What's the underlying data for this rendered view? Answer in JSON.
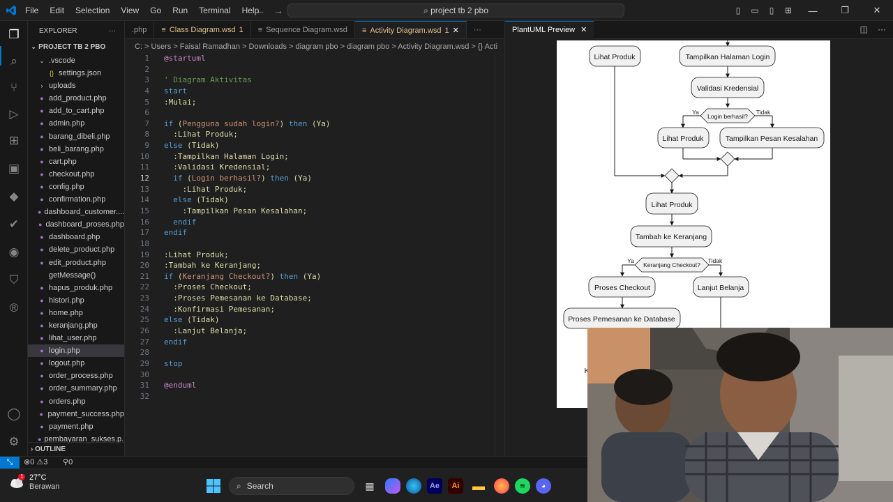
{
  "titlebar": {
    "menu": [
      "File",
      "Edit",
      "Selection",
      "View",
      "Go",
      "Run",
      "Terminal",
      "Help"
    ],
    "search_text": "project tb 2 pbo"
  },
  "explorer": {
    "header": "EXPLORER",
    "project": "PROJECT TB 2 PBO",
    "outline": "OUTLINE",
    "files": [
      {
        "name": ".vscode",
        "kind": "folder-open",
        "indent": 1
      },
      {
        "name": "settings.json",
        "kind": "json",
        "indent": 2
      },
      {
        "name": "uploads",
        "kind": "folder",
        "indent": 1
      },
      {
        "name": "add_product.php",
        "kind": "php",
        "indent": 1
      },
      {
        "name": "add_to_cart.php",
        "kind": "php",
        "indent": 1
      },
      {
        "name": "admin.php",
        "kind": "php",
        "indent": 1
      },
      {
        "name": "barang_dibeli.php",
        "kind": "php",
        "indent": 1
      },
      {
        "name": "beli_barang.php",
        "kind": "php",
        "indent": 1
      },
      {
        "name": "cart.php",
        "kind": "php",
        "indent": 1
      },
      {
        "name": "checkout.php",
        "kind": "php",
        "indent": 1
      },
      {
        "name": "config.php",
        "kind": "php",
        "indent": 1
      },
      {
        "name": "confirmation.php",
        "kind": "php",
        "indent": 1
      },
      {
        "name": "dashboard_customer....",
        "kind": "php",
        "indent": 1
      },
      {
        "name": "dashboard_proses.php",
        "kind": "php",
        "indent": 1
      },
      {
        "name": "dashboard.php",
        "kind": "php",
        "indent": 1
      },
      {
        "name": "delete_product.php",
        "kind": "php",
        "indent": 1
      },
      {
        "name": "edit_product.php",
        "kind": "php",
        "indent": 1
      },
      {
        "name": "getMessage()",
        "kind": "none",
        "indent": 1
      },
      {
        "name": "hapus_produk.php",
        "kind": "php",
        "indent": 1
      },
      {
        "name": "histori.php",
        "kind": "php",
        "indent": 1
      },
      {
        "name": "home.php",
        "kind": "php",
        "indent": 1
      },
      {
        "name": "keranjang.php",
        "kind": "php",
        "indent": 1
      },
      {
        "name": "lihat_user.php",
        "kind": "php",
        "indent": 1
      },
      {
        "name": "login.php",
        "kind": "php",
        "indent": 1,
        "selected": true
      },
      {
        "name": "logout.php",
        "kind": "php",
        "indent": 1
      },
      {
        "name": "order_process.php",
        "kind": "php",
        "indent": 1
      },
      {
        "name": "order_summary.php",
        "kind": "php",
        "indent": 1
      },
      {
        "name": "orders.php",
        "kind": "php",
        "indent": 1
      },
      {
        "name": "payment_success.php",
        "kind": "php",
        "indent": 1
      },
      {
        "name": "payment.php",
        "kind": "php",
        "indent": 1
      },
      {
        "name": "pembayaran_sukses.p...",
        "kind": "php",
        "indent": 1
      }
    ]
  },
  "tabs": [
    {
      "label": ".php",
      "badge": "",
      "active": false
    },
    {
      "label": "Class Diagram.wsd",
      "badge": "1",
      "active": false
    },
    {
      "label": "Sequence Diagram.wsd",
      "badge": "",
      "active": false
    },
    {
      "label": "Activity Diagram.wsd",
      "badge": "1",
      "active": true
    }
  ],
  "breadcrumb": "C: > Users > Faisal Ramadhan > Downloads > diagram pbo > diagram pbo > Activity Diagram.wsd > {} Acti",
  "code": [
    {
      "n": "1",
      "t": "@startuml",
      "c": "bl"
    },
    {
      "n": "2",
      "t": "",
      "c": "pn"
    },
    {
      "n": "3",
      "t": "' Diagram Aktivitas",
      "c": "cm"
    },
    {
      "n": "4",
      "t": "start",
      "c": "kw"
    },
    {
      "n": "5",
      "t": ":Mulai;",
      "c": "fn"
    },
    {
      "n": "6",
      "t": "",
      "c": "pn"
    },
    {
      "n": "7",
      "t": "if (Pengguna sudah login?) then (Ya)",
      "c": "if"
    },
    {
      "n": "8",
      "t": "  :Lihat Produk;",
      "c": "fn"
    },
    {
      "n": "9",
      "t": "else (Tidak)",
      "c": "else"
    },
    {
      "n": "10",
      "t": "  :Tampilkan Halaman Login;",
      "c": "fn"
    },
    {
      "n": "11",
      "t": "  :Validasi Kredensial;",
      "c": "fn"
    },
    {
      "n": "12",
      "t": "  if (Login berhasil?) then (Ya)",
      "c": "if"
    },
    {
      "n": "13",
      "t": "    :Lihat Produk;",
      "c": "fn"
    },
    {
      "n": "14",
      "t": "  else (Tidak)",
      "c": "else"
    },
    {
      "n": "15",
      "t": "    :Tampilkan Pesan Kesalahan;",
      "c": "fn"
    },
    {
      "n": "16",
      "t": "  endif",
      "c": "kw"
    },
    {
      "n": "17",
      "t": "endif",
      "c": "kw"
    },
    {
      "n": "18",
      "t": "",
      "c": "pn"
    },
    {
      "n": "19",
      "t": ":Lihat Produk;",
      "c": "fn"
    },
    {
      "n": "20",
      "t": ":Tambah ke Keranjang;",
      "c": "fn"
    },
    {
      "n": "21",
      "t": "if (Keranjang Checkout?) then (Ya)",
      "c": "if"
    },
    {
      "n": "22",
      "t": "  :Proses Checkout;",
      "c": "fn"
    },
    {
      "n": "23",
      "t": "  :Proses Pemesanan ke Database;",
      "c": "fn"
    },
    {
      "n": "24",
      "t": "  :Konfirmasi Pemesanan;",
      "c": "fn"
    },
    {
      "n": "25",
      "t": "else (Tidak)",
      "c": "else"
    },
    {
      "n": "26",
      "t": "  :Lanjut Belanja;",
      "c": "fn"
    },
    {
      "n": "27",
      "t": "endif",
      "c": "kw"
    },
    {
      "n": "28",
      "t": "",
      "c": "pn"
    },
    {
      "n": "29",
      "t": "stop",
      "c": "kw"
    },
    {
      "n": "30",
      "t": "",
      "c": "pn"
    },
    {
      "n": "31",
      "t": "@enduml",
      "c": "bl"
    },
    {
      "n": "32",
      "t": "",
      "c": "pn"
    }
  ],
  "current_line": "12",
  "preview": {
    "tab_label": "PlantUML Preview",
    "nodes": {
      "lihat_produk_top": "Lihat Produk",
      "tampilkan_login": "Tampilkan Halaman Login",
      "validasi": "Validasi Kredensial",
      "login_berhasil": "Login berhasil?",
      "ya": "Ya",
      "tidak": "Tidak",
      "lihat_produk_mid": "Lihat Produk",
      "pesan_kesalahan": "Tampilkan Pesan Kesalahan",
      "lihat_produk_main": "Lihat Produk",
      "tambah_keranjang": "Tambah ke Keranjang",
      "keranjang_checkout": "Keranjang Checkout?",
      "proses_checkout": "Proses Checkout",
      "lanjut_belanja": "Lanjut Belanja",
      "proses_pemesanan": "Proses Pemesanan ke Database",
      "konfirmasi_partial": "K"
    }
  },
  "status": {
    "errors": "0",
    "warnings": "3",
    "ports": "0"
  },
  "taskbar": {
    "temp": "27°C",
    "weather": "Berawan",
    "notif": "1",
    "search": "Search"
  },
  "colors": {
    "accent": "#0078d4",
    "php": "#a074c4",
    "editor_bg": "#1f1f1f"
  }
}
